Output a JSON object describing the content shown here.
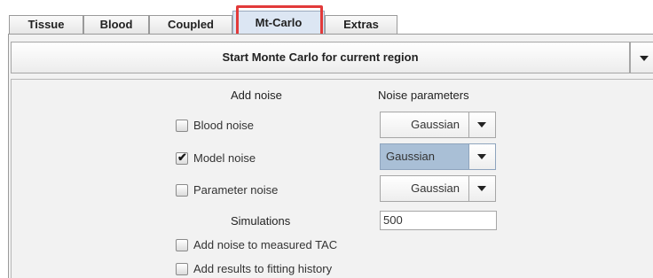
{
  "tabs": [
    {
      "label": "Tissue"
    },
    {
      "label": "Blood"
    },
    {
      "label": "Coupled"
    },
    {
      "label": "Mt-Carlo"
    },
    {
      "label": "Extras"
    }
  ],
  "active_tab": "Mt-Carlo",
  "start_button": {
    "label": "Start Monte Carlo for current region"
  },
  "headers": {
    "add_noise": "Add noise",
    "noise_parameters": "Noise parameters"
  },
  "noise_rows": [
    {
      "label": "Blood noise",
      "checked": false,
      "distribution": "Gaussian"
    },
    {
      "label": "Model noise",
      "checked": true,
      "distribution": "Gaussian"
    },
    {
      "label": "Parameter noise",
      "checked": false,
      "distribution": "Gaussian"
    }
  ],
  "simulations": {
    "label": "Simulations",
    "value": "500"
  },
  "options": [
    {
      "label": "Add noise to measured TAC",
      "checked": false
    },
    {
      "label": "Add results to fitting history",
      "checked": false
    }
  ],
  "icons": {
    "dropdown": "triangle-down-icon",
    "check": "checkmark-icon"
  },
  "colors": {
    "highlight": "#e23a3a",
    "active_tab": "#dce6f3",
    "selected_combo": "#a9bfd6"
  }
}
